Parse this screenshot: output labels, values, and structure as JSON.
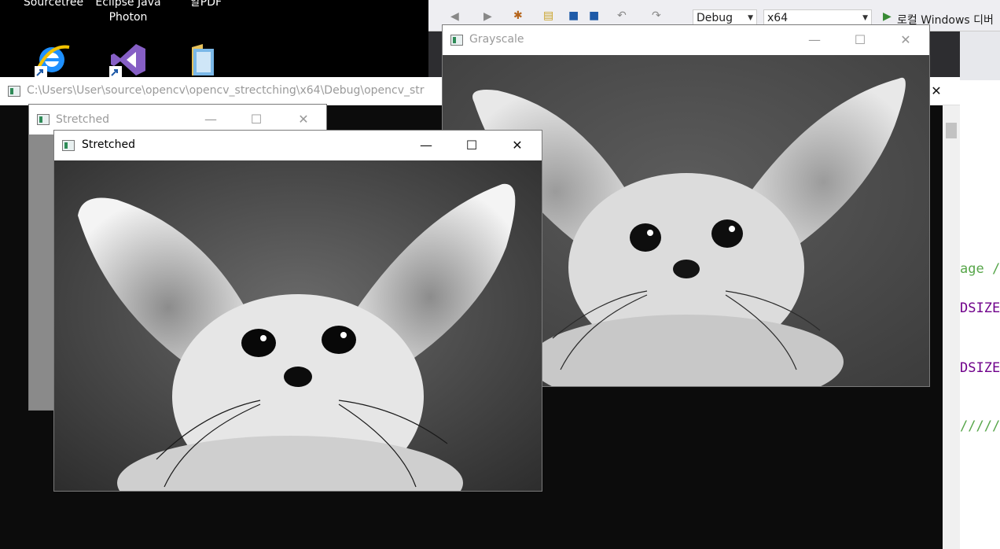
{
  "desktop": {
    "icons": [
      {
        "label_line1": "Sourcetree",
        "label_line2": "",
        "icon": "sourcetree-icon"
      },
      {
        "label_line1": "Eclipse Java",
        "label_line2": "Photon",
        "icon": "visual-studio-icon"
      },
      {
        "label_line1": "알PDF",
        "label_line2": "",
        "icon": "folder-icon"
      }
    ]
  },
  "vs": {
    "config": "Debug",
    "platform": "x64",
    "run_label": "로컬 Windows 디버",
    "code_lines": [
      "age /",
      "DSIZE",
      "DSIZE",
      "/////"
    ]
  },
  "console": {
    "title": "C:\\Users\\User\\source\\opencv\\opencv_strectching\\x64\\Debug\\opencv_str"
  },
  "windows": {
    "stretched_back_title": "Stretched",
    "stretched_title": "Stretched",
    "grayscale_title": "Grayscale"
  },
  "colors": {
    "accent_green": "#2e8b57",
    "console_bg": "#0c0c0c",
    "vs_bg": "#eeeef2",
    "code_green": "#57a64a"
  }
}
